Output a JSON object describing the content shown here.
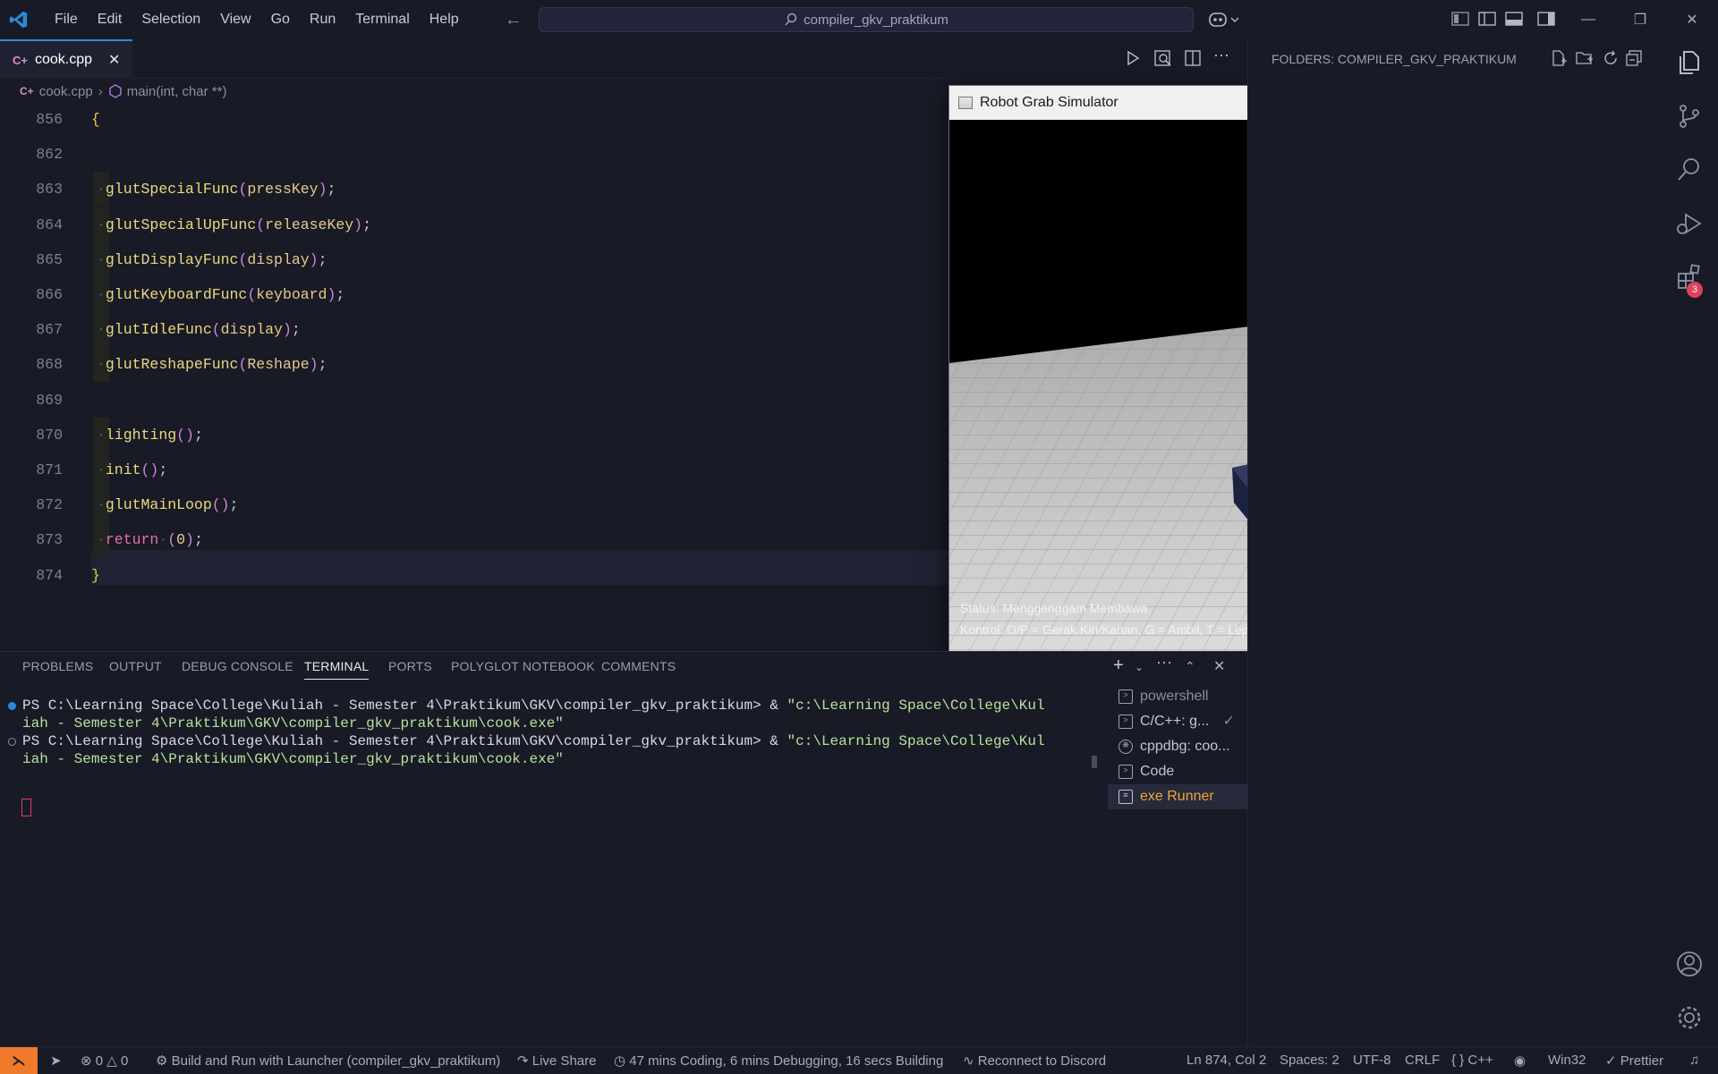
{
  "menu": [
    "File",
    "Edit",
    "Selection",
    "View",
    "Go",
    "Run",
    "Terminal",
    "Help"
  ],
  "search": {
    "text": "compiler_gkv_praktikum"
  },
  "tab": {
    "icon_text": "C+",
    "filename": "cook.cpp"
  },
  "breadcrumb": {
    "file": "cook.cpp",
    "symbol": "main(int, char **)"
  },
  "code_lines": [
    {
      "num": "856",
      "text": "{"
    },
    {
      "num": "862",
      "text": ""
    },
    {
      "num": "863",
      "fn": "glutSpecialFunc",
      "arg": "pressKey"
    },
    {
      "num": "864",
      "fn": "glutSpecialUpFunc",
      "arg": "releaseKey"
    },
    {
      "num": "865",
      "fn": "glutDisplayFunc",
      "arg": "display"
    },
    {
      "num": "866",
      "fn": "glutKeyboardFunc",
      "arg": "keyboard"
    },
    {
      "num": "867",
      "fn": "glutIdleFunc",
      "arg": "display"
    },
    {
      "num": "868",
      "fn": "glutReshapeFunc",
      "arg": "Reshape"
    },
    {
      "num": "869",
      "text": ""
    },
    {
      "num": "870",
      "fn": "lighting",
      "arg": ""
    },
    {
      "num": "871",
      "fn": "init",
      "arg": ""
    },
    {
      "num": "872",
      "fn": "glutMainLoop",
      "arg": ""
    },
    {
      "num": "873",
      "kw": "return",
      "arg": "0"
    },
    {
      "num": "874",
      "text": "}"
    }
  ],
  "simulator": {
    "title": "Robot Grab Simulator",
    "status_line": "Status: Menggenggam Membawa",
    "controls_line": "Kontrol: O/P = Gerak Kiri/Kanan, G = Ambil, T = Lepas, F = Kecepatan, C = Efek Warna"
  },
  "explorer": {
    "header": "FOLDERS: COMPILER_GKV_PRAKTIKUM"
  },
  "panel": {
    "tabs": [
      "PROBLEMS",
      "OUTPUT",
      "DEBUG CONSOLE",
      "TERMINAL",
      "PORTS",
      "POLYGLOT NOTEBOOK",
      "COMMENTS"
    ],
    "active_tab": "TERMINAL"
  },
  "terminal": {
    "lines": [
      {
        "prompt": "PS C:\\Learning Space\\College\\Kuliah - Semester 4\\Praktikum\\GKV\\compiler_gkv_praktikum> & ",
        "str": "\"c:\\Learning Space\\College\\Kul"
      },
      {
        "prompt": "",
        "str": "iah - Semester 4\\Praktikum\\GKV\\compiler_gkv_praktikum\\cook.exe\""
      },
      {
        "prompt": "PS C:\\Learning Space\\College\\Kuliah - Semester 4\\Praktikum\\GKV\\compiler_gkv_praktikum> & ",
        "str": "\"c:\\Learning Space\\College\\Kul"
      },
      {
        "prompt": "",
        "str": "iah - Semester 4\\Praktikum\\GKV\\compiler_gkv_praktikum\\cook.exe\""
      }
    ],
    "sessions": [
      "powershell",
      "C/C++: g...",
      "cppdbg: coo...",
      "Code",
      "exe Runner"
    ]
  },
  "status": {
    "problems": "0",
    "warnings": "0",
    "launch": "Build and Run with Launcher (compiler_gkv_praktikum)",
    "live_share": "Live Share",
    "time": "47 mins Coding, 6 mins Debugging, 16 secs Building",
    "discord": "Reconnect to Discord",
    "position": "Ln 874, Col 2",
    "spaces": "Spaces: 2",
    "encoding": "UTF-8",
    "eol": "CRLF",
    "language": "C++",
    "platform": "Win32",
    "prettier": "Prettier"
  },
  "activity": {
    "extensions_badge": "3"
  },
  "colors": {
    "accent": "#2b8ad8",
    "remote": "#f07a2b",
    "badge": "#e0425b",
    "cube_navy": "#252a4d",
    "cube_red": "#e0305a",
    "cube_blue": "#3a5fe0",
    "cube_green": "#28d44a"
  }
}
